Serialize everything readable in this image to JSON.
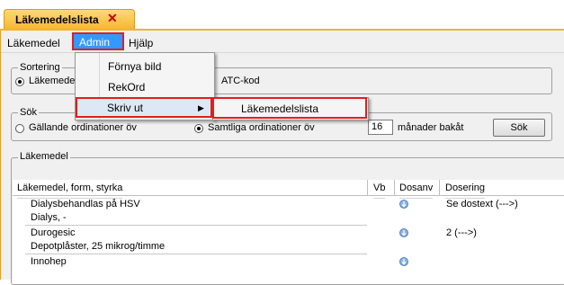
{
  "tab": {
    "title": "Läkemedelslista",
    "close": "✕"
  },
  "menubar": {
    "items": [
      "Läkemedel",
      "Admin",
      "Hjälp"
    ]
  },
  "admin_menu": {
    "items": [
      "Förnya bild",
      "RekOrd",
      "Skriv ut"
    ]
  },
  "submenu": {
    "items": [
      "Läkemedelslista"
    ]
  },
  "sortering": {
    "title": "Sortering",
    "option1": "Läkemedel",
    "option2": "ATC-kod"
  },
  "sok": {
    "title": "Sök",
    "option1": "Gällande ordinationer öv",
    "option2": "Samtliga ordinationer öv",
    "months_value": "16",
    "months_label": "månader bakåt",
    "button": "Sök"
  },
  "lakemedel": {
    "title": "Läkemedel",
    "columns": [
      "Läkemedel, form, styrka",
      "Vb",
      "Dosanv",
      "Dosering"
    ],
    "rows": [
      {
        "name": "Dialysbehandlas på HSV",
        "sub": "Dialys, -",
        "dosering": "Se dostext (--->)"
      },
      {
        "name": "Durogesic",
        "sub": "Depotplåster, 25 mikrog/timme",
        "dosering": "2 (--->)"
      },
      {
        "name": "Innohep",
        "sub": "",
        "dosering": ""
      }
    ]
  },
  "colors": {
    "accent": "#f7b733",
    "highlight_blue": "#3399ff",
    "annotation_red": "#e0201b"
  }
}
